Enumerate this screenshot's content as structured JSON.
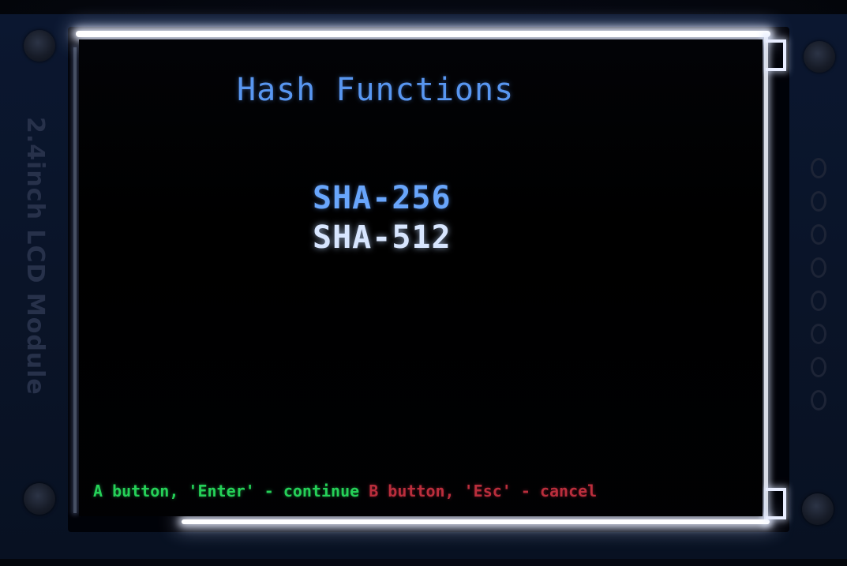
{
  "module": {
    "label": "2.4inch LCD Module"
  },
  "screen": {
    "title": "Hash Functions",
    "menu": {
      "items": [
        {
          "label": "SHA-256"
        },
        {
          "label": "SHA-512"
        }
      ]
    },
    "footer": {
      "continue_hint": "A button, 'Enter' - continue",
      "cancel_hint": "B button, 'Esc' - cancel"
    }
  },
  "colors": {
    "title": "#5ea0ff",
    "menu_item": "#6aa8ff",
    "menu_item_highlighted": "#d8e6ff",
    "continue_hint": "#27e05c",
    "cancel_hint": "#c8303e",
    "background": "#000000"
  },
  "icons": {
    "mounting_hole": "screw-hole-icon",
    "header_pin": "header-pin-icon"
  }
}
